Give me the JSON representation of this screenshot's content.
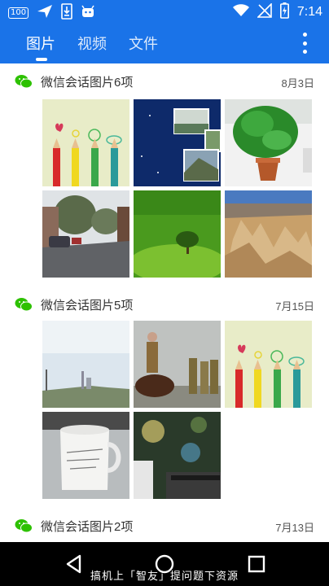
{
  "status_bar": {
    "left_icons": [
      "battery-100-badge",
      "send-icon",
      "download-icon",
      "android-icon"
    ],
    "battery_badge": "100",
    "right_icons": [
      "wifi-icon",
      "no-sim-icon",
      "battery-charging-icon"
    ],
    "time": "7:14"
  },
  "tabs": [
    {
      "label": "图片",
      "active": true
    },
    {
      "label": "视频",
      "active": false
    },
    {
      "label": "文件",
      "active": false
    }
  ],
  "groups": [
    {
      "title": "微信会话图片6项",
      "date": "8月3日",
      "images": [
        "colored-pencils",
        "great-wall-collage",
        "potted-plant",
        "street-scene",
        "green-hill-tree",
        "desert-ruins"
      ]
    },
    {
      "title": "微信会话图片5项",
      "date": "7月15日",
      "images": [
        "city-skyline",
        "soldiers-on-horse",
        "colored-pencils",
        "mug-on-desk",
        "bokeh-desk"
      ]
    },
    {
      "title": "微信会话图片2项",
      "date": "7月13日",
      "images": []
    }
  ],
  "nav": {
    "buttons": [
      "back-icon",
      "home-icon",
      "recents-icon"
    ]
  },
  "watermark": "搞机上「智友」提问题下资源",
  "colors": {
    "primary": "#1a73e8",
    "wechat_green": "#2dc100",
    "nav_bg": "#000000"
  }
}
